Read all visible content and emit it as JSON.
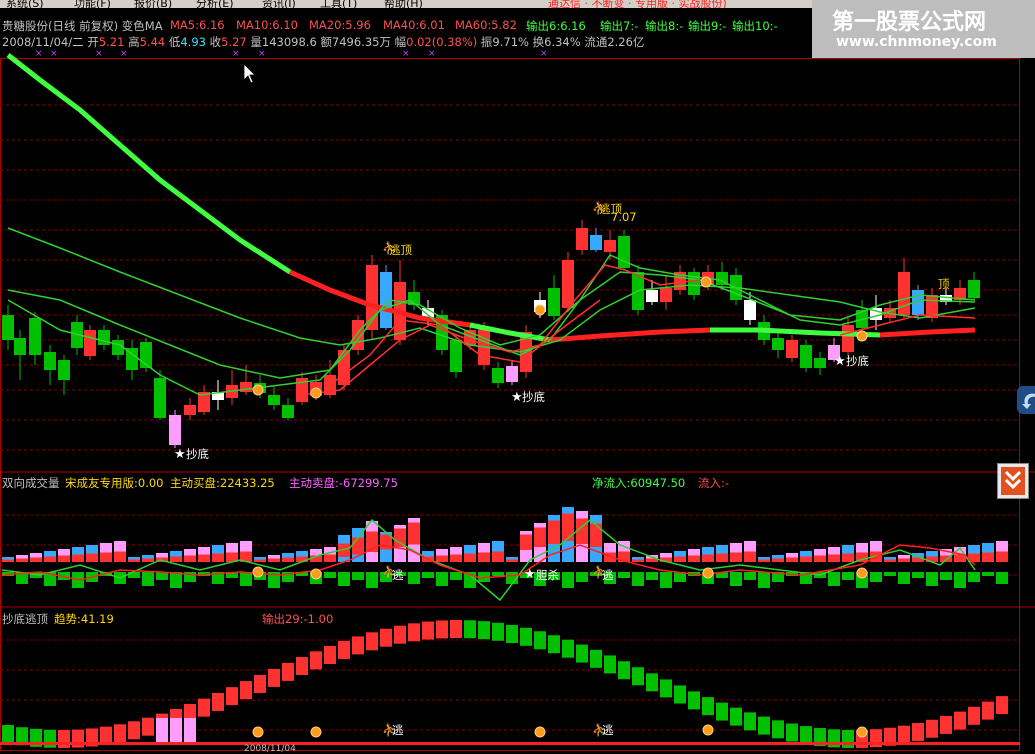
{
  "menu": [
    "系统(S)",
    "功能(F)",
    "报价(B)",
    "分析(E)",
    "资讯(I)",
    "工具(T)",
    "帮助(H)"
  ],
  "menu_extra": "通达信 · 不断变 · 专用版 · 实战股份)",
  "watermark": {
    "line1": "第一股票公式网",
    "line2": "www.chnmoney.com"
  },
  "header": {
    "stock": "贵糖股份(日线 前复权) 变色MA",
    "ma5": "MA5:6.16",
    "ma10": "MA10:6.10",
    "ma20": "MA20:5.96",
    "ma40": "MA40:6.01",
    "ma60": "MA60:5.82",
    "out6": "输出6:6.16",
    "out7": "输出7:-",
    "out8": "输出8:-",
    "out9": "输出9:-",
    "out10": "输出10:-"
  },
  "info": {
    "date": "2008/11/04/二",
    "open_l": "开",
    "open": "5.21",
    "high_l": "高",
    "high": "5.44",
    "low_l": "低",
    "low": "4.93",
    "close_l": "收",
    "close": "5.27",
    "vol_l": "量",
    "vol": "143098.6",
    "amt_l": "额",
    "amt": "7496.35万",
    "chg_l": "幅",
    "chg": "0.02(0.38%)",
    "amp_l": "振",
    "amp": "9.71%",
    "turn_l": "换",
    "turn": "6.34%",
    "float_l": "流通",
    "float": "2.26亿"
  },
  "labels": {
    "top": "逃顶",
    "bottom": "抄底",
    "peak": "7.07",
    "top_short": "顶",
    "kill": "胆杀",
    "escape": "逃"
  },
  "panel2": {
    "title": "双向成交量",
    "v1": "宋成友专用版:0.00",
    "v2": "主动买盘:22433.25",
    "v3": "主动卖盘:-67299.75",
    "v4": "净流入:60947.50",
    "v5": "流入:-"
  },
  "panel3": {
    "title": "抄底逃顶",
    "trend": "趋势:41.19",
    "out29": "输出29:-1.00"
  },
  "bottom_date": "2008/11/04",
  "colors": {
    "up": "#ff3232",
    "down": "#00c000",
    "ma_long": "#00ff40",
    "bg": "#000000"
  },
  "icons": [
    "cursor-arrow-icon",
    "side-nav-icon",
    "down-arrows-icon",
    "star-icon",
    "runner-icon"
  ]
}
